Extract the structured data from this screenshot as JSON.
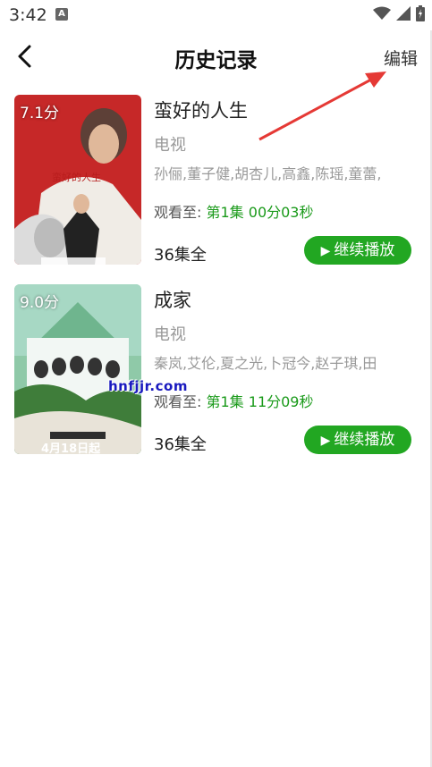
{
  "status_bar": {
    "time": "3:42",
    "notif_letter": "A"
  },
  "header": {
    "title": "历史记录",
    "edit_label": "编辑"
  },
  "watermark": "hnfjjr.com",
  "items": [
    {
      "rating": "7.1分",
      "title": "蛮好的人生",
      "category": "电视",
      "cast": "孙俪,董子健,胡杏儿,高鑫,陈瑶,童蕾,",
      "progress_prefix": "观看至:",
      "progress_value": "第1集 00分03秒",
      "episodes": "36集全",
      "continue_label": "继续播放"
    },
    {
      "rating": "9.0分",
      "title": "成家",
      "category": "电视",
      "cast": "秦岚,艾伦,夏之光,卜冠今,赵子琪,田",
      "progress_prefix": "观看至:",
      "progress_value": "第1集 11分09秒",
      "episodes": "36集全",
      "continue_label": "继续播放"
    }
  ],
  "colors": {
    "accent_green": "#22a722",
    "arrow_red": "#e53935"
  }
}
